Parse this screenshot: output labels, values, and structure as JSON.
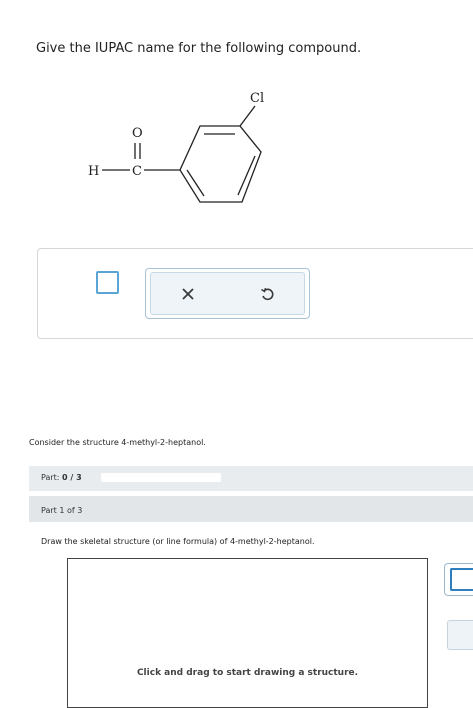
{
  "question": "Give the IUPAC name for the following compound.",
  "molecule": {
    "chlorine_label": "Cl",
    "oxygen_label": "O",
    "hydrogen_label": "H",
    "carbon_label": "C"
  },
  "answer_toolbar": {
    "clear_icon": "x-icon",
    "undo_icon": "undo-icon"
  },
  "consider_text": "Consider the structure 4-methyl-2-heptanol.",
  "progress": {
    "part_prefix": "Part: ",
    "part_value": "0 / 3",
    "fraction_complete": 0
  },
  "part_of_label": "Part 1 of 3",
  "draw_instruction": "Draw the skeletal structure (or line formula) of 4-methyl-2-heptanol.",
  "canvas_hint": "Click and drag to start drawing a structure.",
  "colors": {
    "accent": "#5aa4d6",
    "toolbar_bg": "#eef4f8",
    "progress_fill": "#4a90c8"
  }
}
